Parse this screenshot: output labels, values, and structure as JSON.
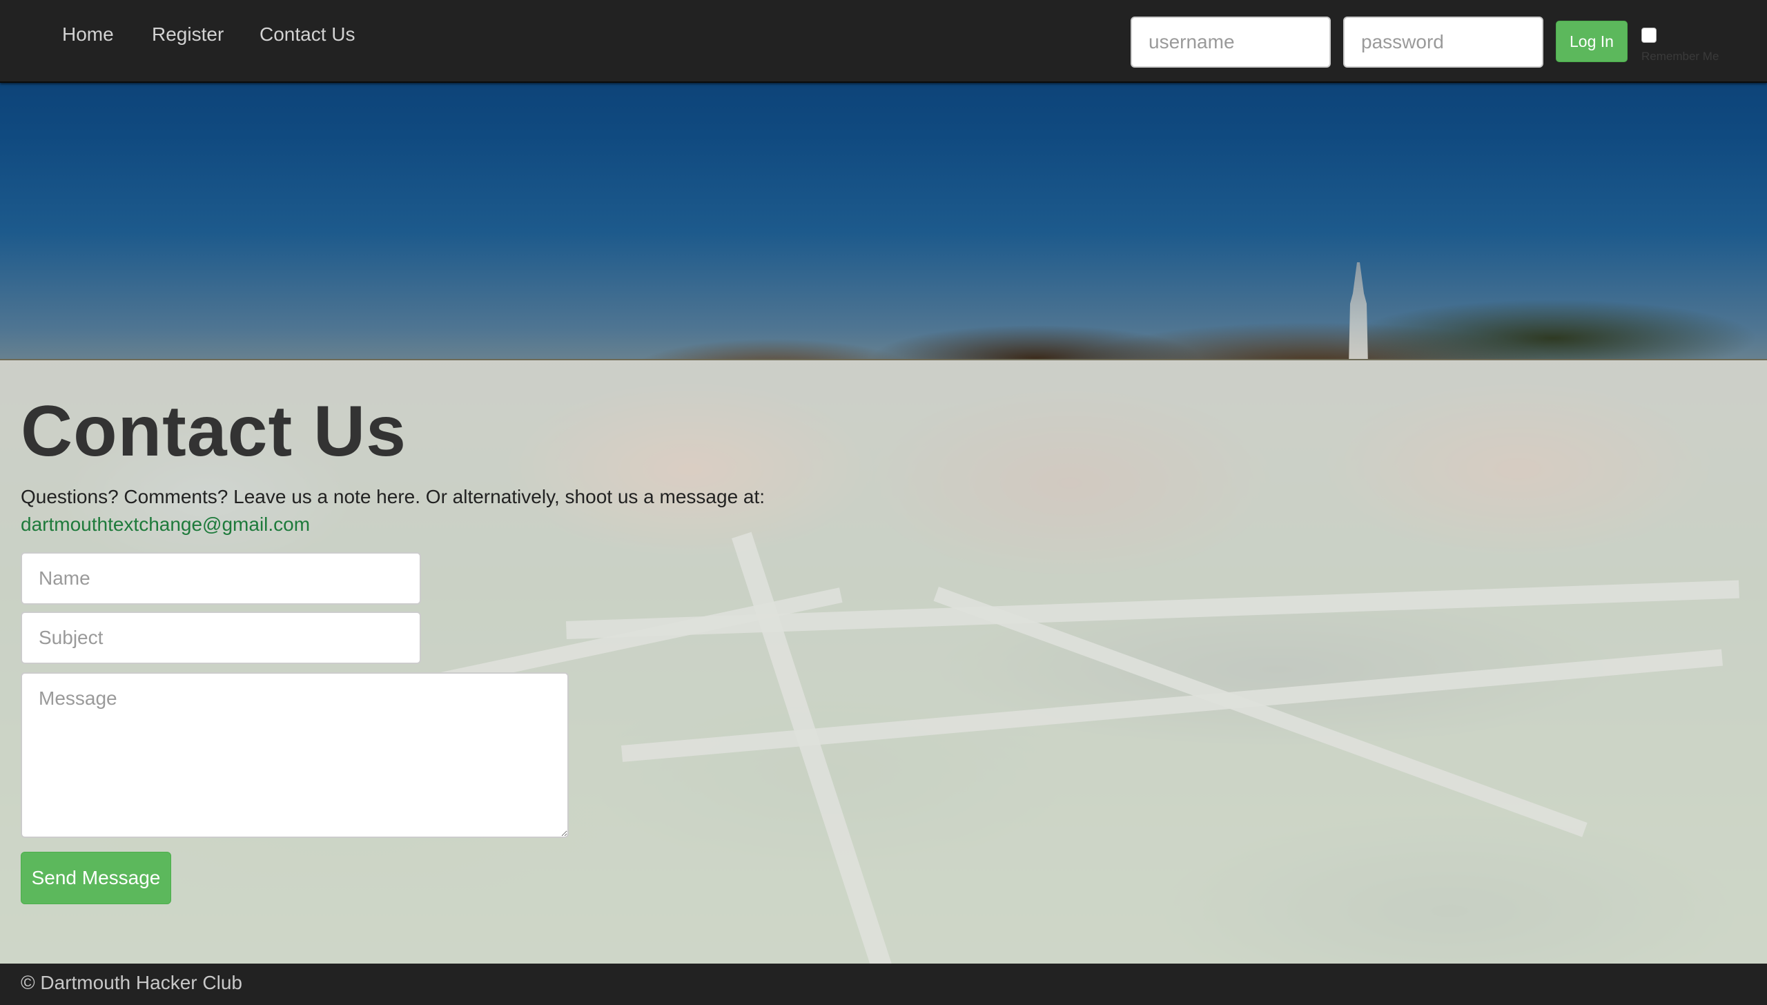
{
  "navbar": {
    "links": [
      {
        "label": "Home"
      },
      {
        "label": "Register"
      },
      {
        "label": "Contact Us"
      }
    ],
    "login": {
      "username_placeholder": "username",
      "username_value": "",
      "password_placeholder": "password",
      "password_value": "",
      "button_label": "Log In",
      "remember_label": "Remember Me",
      "remember_checked": false
    }
  },
  "main": {
    "title": "Contact Us",
    "intro": "Questions? Comments? Leave us a note here. Or alternatively, shoot us a message at:",
    "email": "dartmouthtextchange@gmail.com",
    "form": {
      "name_placeholder": "Name",
      "name_value": "",
      "subject_placeholder": "Subject",
      "subject_value": "",
      "message_placeholder": "Message",
      "message_value": "",
      "submit_label": "Send Message"
    }
  },
  "footer": {
    "text": "© Dartmouth Hacker Club"
  },
  "colors": {
    "navbar_bg": "#222222",
    "accent_green": "#5cb85c",
    "link_green": "#1e7a3b",
    "title_text": "#333333"
  }
}
